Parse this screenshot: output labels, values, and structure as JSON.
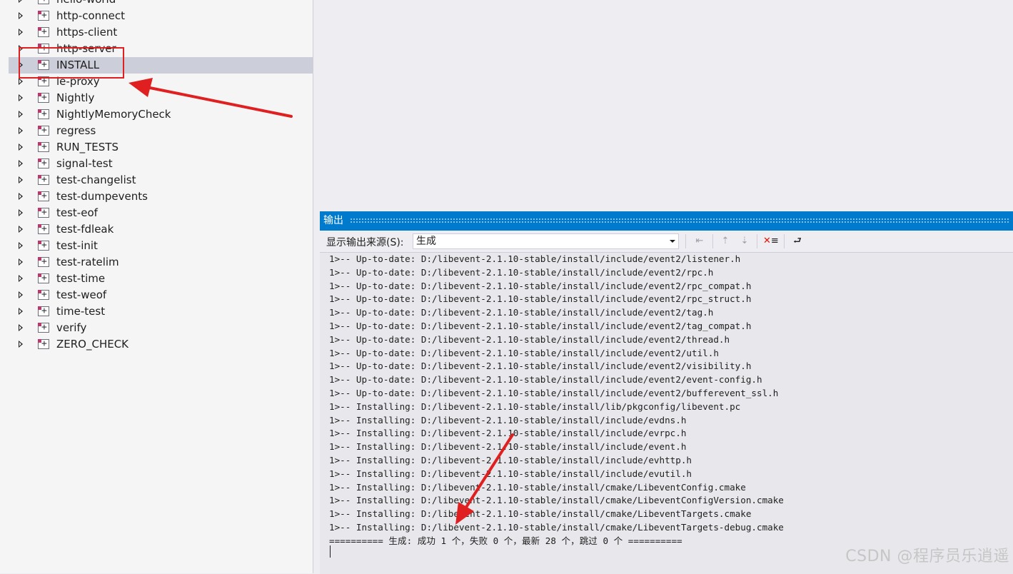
{
  "tree": {
    "items": [
      {
        "label": "hello-world",
        "selected": false
      },
      {
        "label": "http-connect",
        "selected": false
      },
      {
        "label": "https-client",
        "selected": false
      },
      {
        "label": "http-server",
        "selected": false
      },
      {
        "label": "INSTALL",
        "selected": true
      },
      {
        "label": "le-proxy",
        "selected": false
      },
      {
        "label": "Nightly",
        "selected": false
      },
      {
        "label": "NightlyMemoryCheck",
        "selected": false
      },
      {
        "label": "regress",
        "selected": false
      },
      {
        "label": "RUN_TESTS",
        "selected": false
      },
      {
        "label": "signal-test",
        "selected": false
      },
      {
        "label": "test-changelist",
        "selected": false
      },
      {
        "label": "test-dumpevents",
        "selected": false
      },
      {
        "label": "test-eof",
        "selected": false
      },
      {
        "label": "test-fdleak",
        "selected": false
      },
      {
        "label": "test-init",
        "selected": false
      },
      {
        "label": "test-ratelim",
        "selected": false
      },
      {
        "label": "test-time",
        "selected": false
      },
      {
        "label": "test-weof",
        "selected": false
      },
      {
        "label": "time-test",
        "selected": false
      },
      {
        "label": "verify",
        "selected": false
      },
      {
        "label": "ZERO_CHECK",
        "selected": false
      }
    ]
  },
  "output": {
    "title": "输出",
    "source_label": "显示输出来源(S):",
    "source_value": "生成",
    "lines": [
      "1>-- Up-to-date: D:/libevent-2.1.10-stable/install/include/event2/listener.h",
      "1>-- Up-to-date: D:/libevent-2.1.10-stable/install/include/event2/rpc.h",
      "1>-- Up-to-date: D:/libevent-2.1.10-stable/install/include/event2/rpc_compat.h",
      "1>-- Up-to-date: D:/libevent-2.1.10-stable/install/include/event2/rpc_struct.h",
      "1>-- Up-to-date: D:/libevent-2.1.10-stable/install/include/event2/tag.h",
      "1>-- Up-to-date: D:/libevent-2.1.10-stable/install/include/event2/tag_compat.h",
      "1>-- Up-to-date: D:/libevent-2.1.10-stable/install/include/event2/thread.h",
      "1>-- Up-to-date: D:/libevent-2.1.10-stable/install/include/event2/util.h",
      "1>-- Up-to-date: D:/libevent-2.1.10-stable/install/include/event2/visibility.h",
      "1>-- Up-to-date: D:/libevent-2.1.10-stable/install/include/event2/event-config.h",
      "1>-- Up-to-date: D:/libevent-2.1.10-stable/install/include/event2/bufferevent_ssl.h",
      "1>-- Installing: D:/libevent-2.1.10-stable/install/lib/pkgconfig/libevent.pc",
      "1>-- Installing: D:/libevent-2.1.10-stable/install/include/evdns.h",
      "1>-- Installing: D:/libevent-2.1.10-stable/install/include/evrpc.h",
      "1>-- Installing: D:/libevent-2.1.10-stable/install/include/event.h",
      "1>-- Installing: D:/libevent-2.1.10-stable/install/include/evhttp.h",
      "1>-- Installing: D:/libevent-2.1.10-stable/install/include/evutil.h",
      "1>-- Installing: D:/libevent-2.1.10-stable/install/cmake/LibeventConfig.cmake",
      "1>-- Installing: D:/libevent-2.1.10-stable/install/cmake/LibeventConfigVersion.cmake",
      "1>-- Installing: D:/libevent-2.1.10-stable/install/cmake/LibeventTargets.cmake",
      "1>-- Installing: D:/libevent-2.1.10-stable/install/cmake/LibeventTargets-debug.cmake",
      "========== 生成: 成功 1 个，失败 0 个，最新 28 个，跳过 0 个 =========="
    ]
  },
  "toolbar_icons": [
    "go-to-line-icon",
    "prev-message-icon",
    "next-message-icon",
    "clear-all-icon",
    "word-wrap-icon"
  ],
  "colors": {
    "title_bar": "#007acc",
    "selection": "#ccced9",
    "annotation": "#e02020"
  },
  "watermark": "CSDN @程序员乐逍遥"
}
